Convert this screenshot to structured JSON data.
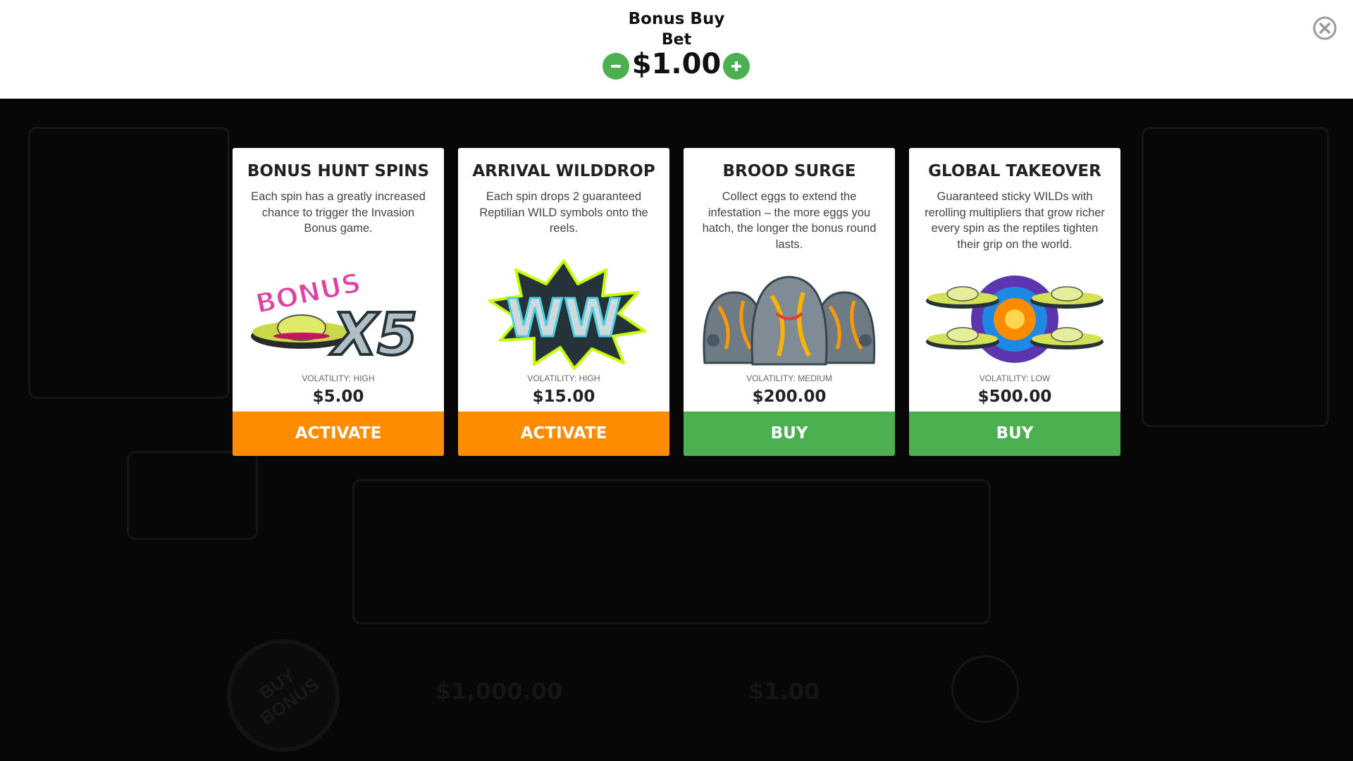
{
  "header": {
    "title": "Bonus Buy",
    "bet_label": "Bet",
    "bet_value": "$1.00"
  },
  "colors": {
    "activate": "#ff8c00",
    "buy": "#4caf50",
    "stepper": "#4caf50"
  },
  "icons": [
    "minus-icon",
    "plus-icon",
    "close-icon"
  ],
  "cards": [
    {
      "title": "BONUS HUNT SPINS",
      "description": "Each spin has a greatly increased chance to trigger the Invasion Bonus game.",
      "art_text": "BONUS",
      "art_multiplier": "X5",
      "volatility": "VOLATILITY: HIGH",
      "price": "$5.00",
      "button": "ACTIVATE"
    },
    {
      "title": "ARRIVAL WILDDROP",
      "description": "Each spin drops 2 guaranteed Reptilian WILD symbols onto the reels.",
      "art_text": "WW",
      "volatility": "VOLATILITY: HIGH",
      "price": "$15.00",
      "button": "ACTIVATE"
    },
    {
      "title": "BROOD SURGE",
      "description": "Collect eggs to extend the infestation – the more eggs you hatch, the longer the bonus round lasts.",
      "volatility": "VOLATILITY: MEDIUM",
      "price": "$200.00",
      "button": "BUY"
    },
    {
      "title": "GLOBAL TAKEOVER",
      "description": "Guaranteed sticky WILDs with rerolling multipliers that grow richer every spin as the reptiles tighten their grip on the world.",
      "volatility": "VOLATILITY: LOW",
      "price": "$500.00",
      "button": "BUY"
    }
  ],
  "background_game": {
    "buy_bonus_label": "BUY BONUS",
    "balance": "$1,000.00",
    "bet": "$1.00"
  }
}
